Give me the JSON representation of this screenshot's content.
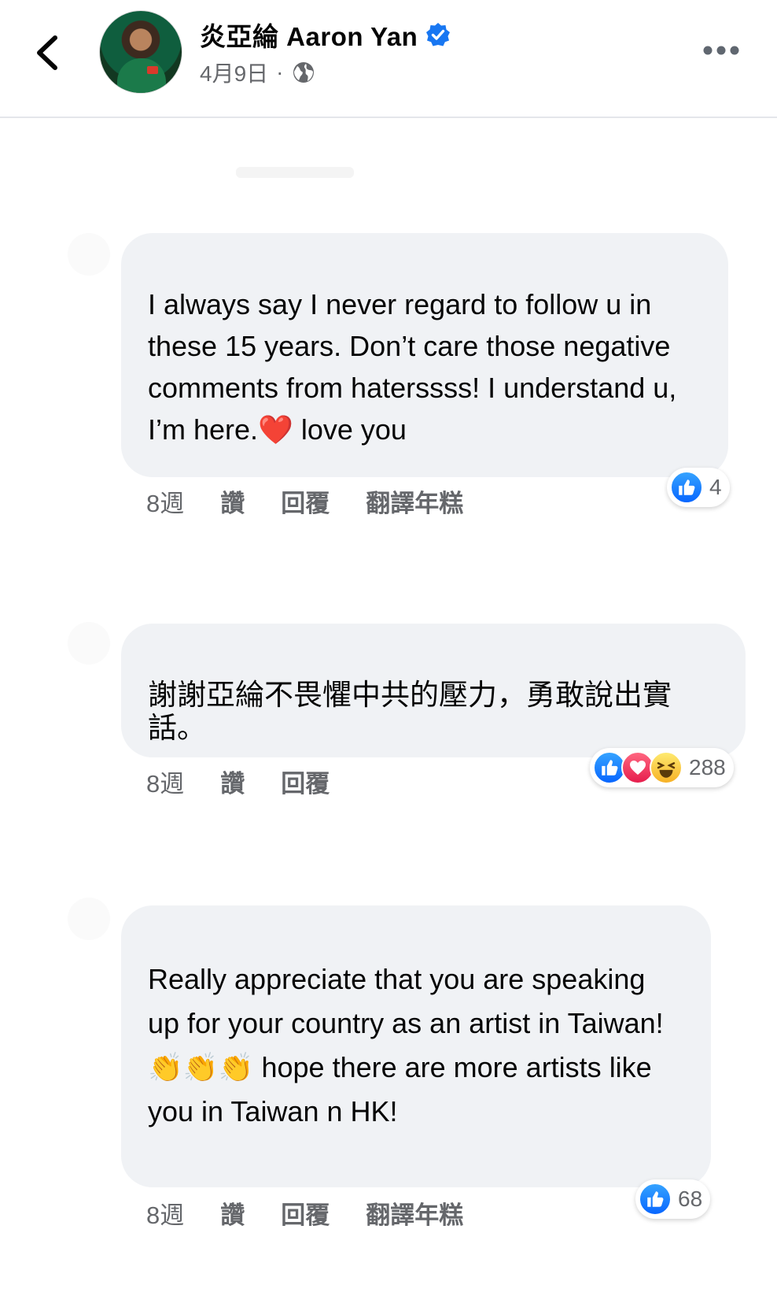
{
  "header": {
    "page_name": "炎亞綸 Aaron Yan",
    "post_date": "4月9日",
    "separator": "·",
    "icons": [
      "back-chevron-icon",
      "verified-badge-icon",
      "globe-icon",
      "more-options-icon"
    ],
    "accent_color": "#1877f2"
  },
  "comments": [
    {
      "text": "I always say I never regard to follow u in these 15 years. Don’t care those negative comments from haterssss! I understand u, I’m here.❤️ love you",
      "time": "8週",
      "like_label": "讚",
      "reply_label": "回覆",
      "translate_label": "翻譯年糕",
      "reactions": [
        "like"
      ],
      "reaction_count": "4"
    },
    {
      "text": "謝謝亞綸不畏懼中共的壓力，勇敢說出實話。",
      "time": "8週",
      "like_label": "讚",
      "reply_label": "回覆",
      "reactions": [
        "like",
        "love",
        "haha"
      ],
      "reaction_count": "288"
    },
    {
      "text": "Really appreciate that you are speaking up for your country as an artist in Taiwan! 👏👏👏 hope there are more artists like you in Taiwan n HK!",
      "time": "8週",
      "like_label": "讚",
      "reply_label": "回覆",
      "translate_label": "翻譯年糕",
      "reactions": [
        "like"
      ],
      "reaction_count": "68"
    }
  ]
}
